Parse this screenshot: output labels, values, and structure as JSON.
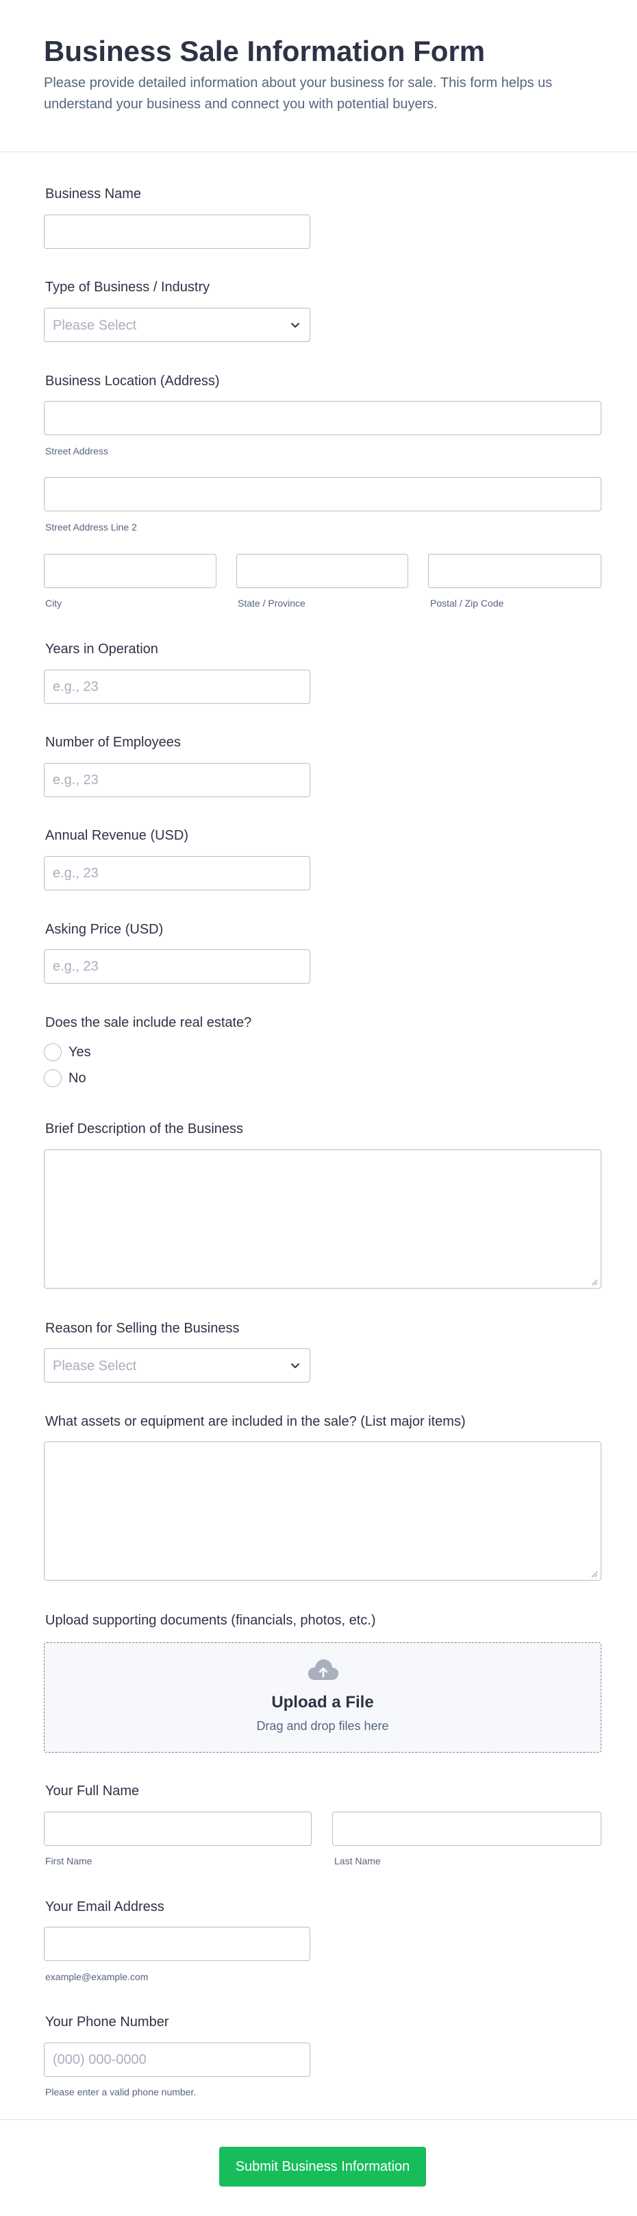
{
  "header": {
    "title": "Business Sale Information Form",
    "subtitle": "Please provide detailed information about your business for sale. This form helps us understand your business and connect you with potential buyers."
  },
  "business_name": {
    "label": "Business Name"
  },
  "business_type": {
    "label": "Type of Business / Industry",
    "placeholder": "Please Select"
  },
  "location": {
    "label": "Business Location (Address)",
    "street": "Street Address",
    "street2": "Street Address Line 2",
    "city": "City",
    "state": "State / Province",
    "postal": "Postal / Zip Code"
  },
  "years": {
    "label": "Years in Operation",
    "placeholder": "e.g., 23"
  },
  "employees": {
    "label": "Number of Employees",
    "placeholder": "e.g., 23"
  },
  "revenue": {
    "label": "Annual Revenue (USD)",
    "placeholder": "e.g., 23"
  },
  "price": {
    "label": "Asking Price (USD)",
    "placeholder": "e.g., 23"
  },
  "real_estate": {
    "label": "Does the sale include real estate?",
    "options": [
      "Yes",
      "No"
    ]
  },
  "description": {
    "label": "Brief Description of the Business"
  },
  "reason": {
    "label": "Reason for Selling the Business",
    "placeholder": "Please Select"
  },
  "assets": {
    "label": "What assets or equipment are included in the sale? (List major items)"
  },
  "upload": {
    "label": "Upload supporting documents (financials, photos, etc.)",
    "title": "Upload a File",
    "hint": "Drag and drop files here",
    "icon": "cloud-upload-icon"
  },
  "full_name": {
    "label": "Your Full Name",
    "first": "First Name",
    "last": "Last Name"
  },
  "email": {
    "label": "Your Email Address",
    "hint": "example@example.com"
  },
  "phone": {
    "label": "Your Phone Number",
    "placeholder": "(000) 000-0000",
    "hint": "Please enter a valid phone number."
  },
  "submit": {
    "label": "Submit Business Information"
  },
  "colors": {
    "accent": "#18bd5b",
    "text": "#2c3345",
    "muted": "#57647e",
    "border": "#b8bdc9"
  }
}
